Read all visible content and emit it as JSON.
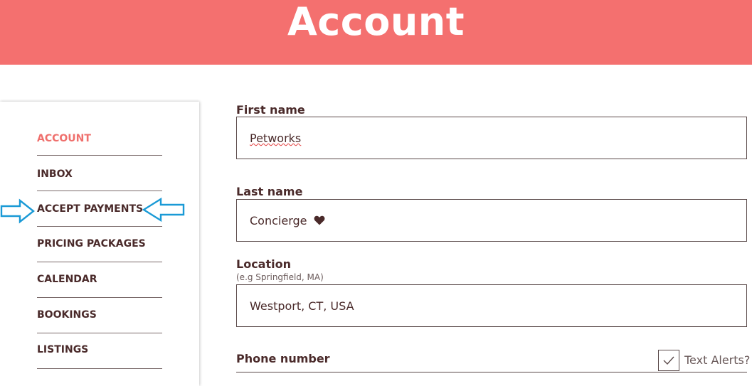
{
  "header": {
    "title": "Account",
    "bg_color": "#f4706f"
  },
  "sidebar": {
    "items": [
      {
        "label": "ACCOUNT",
        "active": true
      },
      {
        "label": "INBOX",
        "active": false
      },
      {
        "label": "ACCEPT PAYMENTS",
        "active": false
      },
      {
        "label": "PRICING PACKAGES",
        "active": false
      },
      {
        "label": "CALENDAR",
        "active": false
      },
      {
        "label": "BOOKINGS",
        "active": false
      },
      {
        "label": "LISTINGS",
        "active": false
      }
    ],
    "active_color": "#ef6f6c",
    "annotation": {
      "target": "ACCEPT PAYMENTS",
      "icon": "arrow-icon",
      "color": "#1a9ad6"
    }
  },
  "form": {
    "first_name": {
      "label": "First name",
      "value": "Petworks"
    },
    "last_name": {
      "label": "Last name",
      "value": "Concierge",
      "suffix_icon": "heart-icon"
    },
    "location": {
      "label": "Location",
      "hint": "(e.g Springfield, MA)",
      "value": "Westport, CT, USA"
    },
    "phone": {
      "label": "Phone number",
      "text_alerts_label": "Text Alerts?",
      "text_alerts_checked": true
    }
  }
}
